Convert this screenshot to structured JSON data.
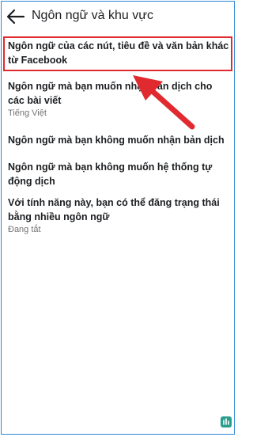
{
  "header": {
    "title": "Ngôn ngữ và khu vực",
    "back_icon": "arrow-left-icon"
  },
  "settings": [
    {
      "label": "Ngôn ngữ của các nút, tiêu đề và văn bản khác từ Facebook",
      "value": ""
    },
    {
      "label": "Ngôn ngữ mà bạn muốn nhận bản dịch cho các bài viết",
      "value": "Tiếng Việt"
    },
    {
      "label": "Ngôn ngữ mà bạn không muốn nhận bản dịch",
      "value": ""
    },
    {
      "label": "Ngôn ngữ mà bạn không muốn hệ thống tự động dịch",
      "value": ""
    },
    {
      "label": "Với tính năng này, bạn có thể đăng trạng thái bằng nhiều ngôn ngữ",
      "value": "Đang tắt"
    }
  ],
  "colors": {
    "highlight": "#e02a30",
    "arrow": "#e02a30",
    "frame": "#2e88d6",
    "text": "#1c1e21",
    "secondary_text": "#737373"
  }
}
